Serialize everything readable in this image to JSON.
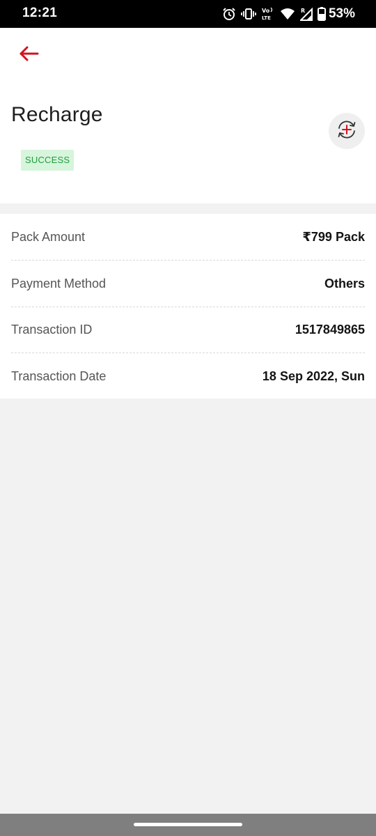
{
  "status_bar": {
    "time": "12:21",
    "battery_percent": "53%",
    "icons": [
      "alarm-icon",
      "vibrate-icon",
      "volte-icon",
      "wifi-icon",
      "cellular-signal-icon",
      "battery-icon"
    ]
  },
  "header": {
    "back_icon": "back-arrow-icon",
    "title": "Recharge",
    "status": "SUCCESS",
    "repeat_icon": "repeat-recharge-icon"
  },
  "details": [
    {
      "label": "Pack Amount",
      "value": "₹799 Pack"
    },
    {
      "label": "Payment Method",
      "value": "Others"
    },
    {
      "label": "Transaction ID",
      "value": "1517849865"
    },
    {
      "label": "Transaction Date",
      "value": "18 Sep 2022, Sun"
    }
  ],
  "colors": {
    "accent": "#d3121f",
    "success_text": "#1f9d3a",
    "success_bg": "#d6f5dc",
    "page_bg": "#f2f2f2"
  }
}
